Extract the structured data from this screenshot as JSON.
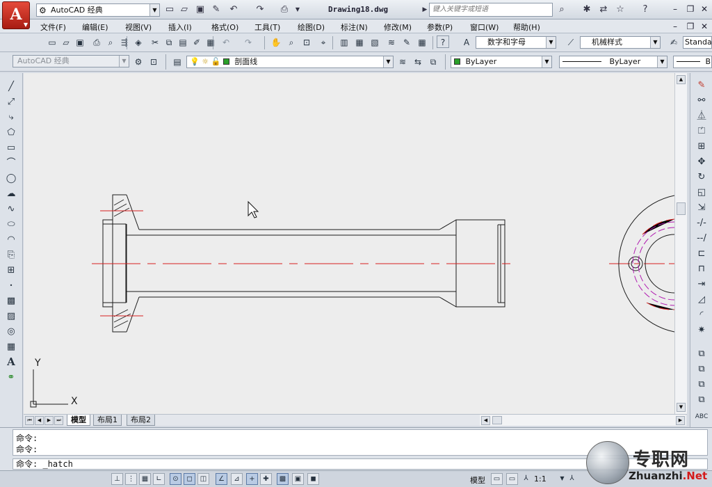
{
  "titlebar": {
    "workspace": "AutoCAD 经典",
    "document": "Drawing18.dwg",
    "search_placeholder": "键入关键字或短语"
  },
  "menu": [
    "文件(F)",
    "编辑(E)",
    "视图(V)",
    "插入(I)",
    "格式(O)",
    "工具(T)",
    "绘图(D)",
    "标注(N)",
    "修改(M)",
    "参数(P)",
    "窗口(W)",
    "帮助(H)"
  ],
  "styles": {
    "text_style": "数字和字母",
    "dim_style": "机械样式",
    "table_style": "Standa"
  },
  "layers": {
    "workspace": "AutoCAD 经典",
    "current_layer": "剖面线",
    "layer_color": "#2aa02a",
    "color": "ByLayer",
    "linetype": "ByLayer",
    "lineweight": "B"
  },
  "tabs": [
    "模型",
    "布局1",
    "布局2"
  ],
  "command": {
    "history": [
      "命令:",
      "命令:"
    ],
    "current": "命令:  _hatch"
  },
  "status": {
    "space": "模型",
    "scale": "1:1"
  },
  "watermark": {
    "title": "专职网",
    "url_prefix": "Zhuanzhi",
    "url_suffix": ".Net"
  },
  "ucs": {
    "x_label": "X",
    "y_label": "Y"
  },
  "colors": {
    "centerline": "#d81e1e",
    "geometry": "#1a1a1a",
    "hidden": "#b01ab0"
  }
}
